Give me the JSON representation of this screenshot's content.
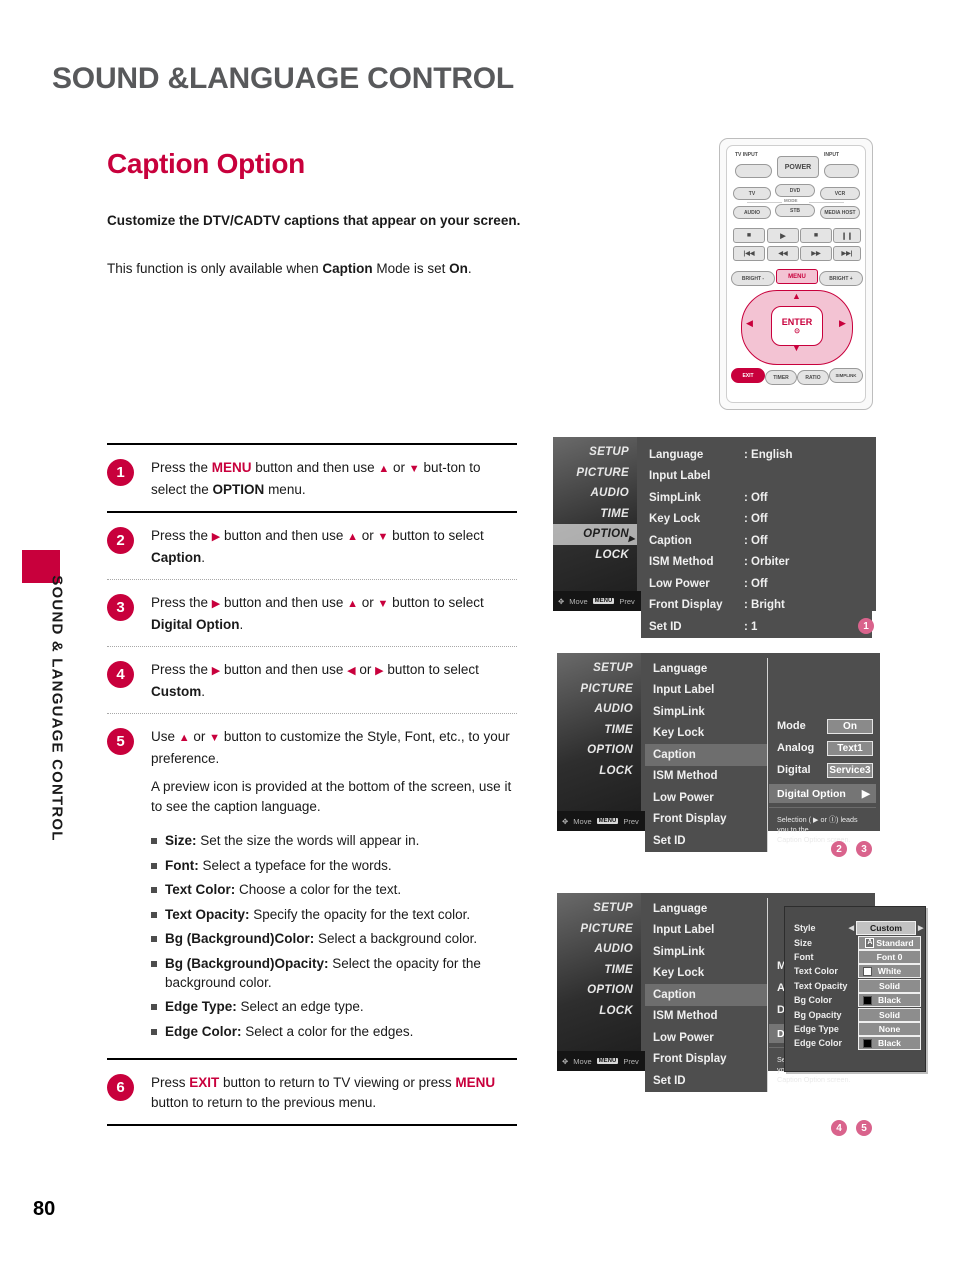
{
  "header": {
    "chapter": "SOUND &LANGUAGE CONTROL",
    "section": "Caption Option",
    "lead_bold": "Customize the DTV/CADTV captions that appear on your screen.",
    "lead_pre": "This function is only available when ",
    "lead_b1": "Caption",
    "lead_mid": " Mode is set ",
    "lead_b2": "On",
    "lead_end": "."
  },
  "sidebar": {
    "vertical_label": "SOUND & LANGUAGE CONTROL",
    "page_number": "80"
  },
  "steps": [
    {
      "num": "1",
      "pre": "Press the ",
      "k1": "MENU",
      "mid1": " button and then use ",
      "up": "▲",
      "or": " or ",
      "down": "▼",
      "mid2": " but-ton to select the ",
      "k2": "OPTION",
      "end": " menu."
    },
    {
      "num": "2",
      "pre": "Press the ",
      "k1": "▶",
      "mid1": " button and then use ",
      "up": "▲",
      "or": " or ",
      "down": "▼",
      "mid2": " button to select ",
      "k2": "Caption",
      "end": "."
    },
    {
      "num": "3",
      "pre": "Press the ",
      "k1": "▶",
      "mid1": " button and then use ",
      "up": "▲",
      "or": " or ",
      "down": "▼",
      "mid2": " button to select ",
      "k2": "Digital Option",
      "end": "."
    },
    {
      "num": "4",
      "pre": "Press the ",
      "k1": "▶",
      "mid1": " button and then use ",
      "up": "◀",
      "or": " or ",
      "down": "▶",
      "mid2": " button to select ",
      "k2": "Custom",
      "end": "."
    }
  ],
  "step5": {
    "num": "5",
    "pre": "Use ",
    "up": "▲",
    "or": " or ",
    "down": "▼",
    "post": " button to customize the Style, Font, etc., to your preference.",
    "para2": "A preview icon is provided at the bottom of the screen, use it to see the caption language.",
    "items": [
      {
        "term": "Size:",
        "desc": " Set the size the words will appear in."
      },
      {
        "term": "Font:",
        "desc": " Select a typeface for the words."
      },
      {
        "term": "Text Color:",
        "desc": " Choose a color for the text."
      },
      {
        "term": "Text Opacity:",
        "desc": " Specify the opacity for the text color."
      },
      {
        "term": "Bg (Background)Color:",
        "desc": " Select a background color."
      },
      {
        "term": "Bg (Background)Opacity:",
        "desc": " Select the opacity for the background color."
      },
      {
        "term": "Edge Type:",
        "desc": " Select an edge type."
      },
      {
        "term": "Edge Color:",
        "desc": " Select a color for the edges."
      }
    ]
  },
  "step6": {
    "num": "6",
    "pre": "Press ",
    "k1": "EXIT",
    "mid": " button to return to TV viewing or press ",
    "k2": "MENU",
    "end": " button to return to the previous menu."
  },
  "tv_menu": {
    "categories": [
      "SETUP",
      "PICTURE",
      "AUDIO",
      "TIME",
      "OPTION",
      "LOCK"
    ],
    "selected_category": "OPTION",
    "footer_move": "Move",
    "footer_menu_key": "MENU",
    "footer_prev": "Prev",
    "option_items": [
      {
        "label": "Language",
        "value": ": English"
      },
      {
        "label": "Input Label",
        "value": ""
      },
      {
        "label": "SimpLink",
        "value": ": Off"
      },
      {
        "label": "Key Lock",
        "value": ": Off"
      },
      {
        "label": "Caption",
        "value": ": Off"
      },
      {
        "label": "ISM Method",
        "value": ": Orbiter"
      },
      {
        "label": "Low Power",
        "value": ": Off"
      },
      {
        "label": "Front Display",
        "value": ": Bright"
      },
      {
        "label": "Set ID",
        "value": ": 1"
      }
    ],
    "option_items_plain": [
      "Language",
      "Input Label",
      "SimpLink",
      "Key Lock",
      "Caption",
      "ISM Method",
      "Low Power",
      "Front Display",
      "Set ID"
    ],
    "caption_panel": {
      "rows": [
        {
          "label": "Mode",
          "value": "On"
        },
        {
          "label": "Analog",
          "value": "Text1"
        },
        {
          "label": "Digital",
          "value": "Service3"
        }
      ],
      "digital_option_label": "Digital Option",
      "digital_option_arrow": "▶",
      "note_line1": "Selection ( ▶ or Ⓘ) leads you to the",
      "note_line2": "Caption Option screen."
    },
    "caption_option_panel": {
      "rows": [
        {
          "label": "Style",
          "value": "Custom",
          "swatch": "",
          "arrows": true,
          "highlight": true,
          "aicon": false
        },
        {
          "label": "Size",
          "value": "Standard",
          "swatch": "",
          "arrows": false,
          "highlight": false,
          "aicon": true
        },
        {
          "label": "Font",
          "value": "Font  0",
          "swatch": "",
          "arrows": false,
          "highlight": false,
          "aicon": false
        },
        {
          "label": "Text Color",
          "value": "White",
          "swatch": "#ffffff",
          "arrows": false,
          "highlight": false,
          "aicon": false
        },
        {
          "label": "Text Opacity",
          "value": "Solid",
          "swatch": "",
          "arrows": false,
          "highlight": false,
          "aicon": false
        },
        {
          "label": "Bg Color",
          "value": "Black",
          "swatch": "#000000",
          "arrows": false,
          "highlight": false,
          "aicon": false
        },
        {
          "label": "Bg Opacity",
          "value": "Solid",
          "swatch": "",
          "arrows": false,
          "highlight": false,
          "aicon": false
        },
        {
          "label": "Edge Type",
          "value": "None",
          "swatch": "",
          "arrows": false,
          "highlight": false,
          "aicon": false
        },
        {
          "label": "Edge Color",
          "value": "Black",
          "swatch": "#000000",
          "arrows": false,
          "highlight": false,
          "aicon": false
        }
      ],
      "arrow_left": "◀",
      "arrow_right": "▶"
    }
  },
  "markers": {
    "shot1": [
      "1"
    ],
    "shot2": [
      "2",
      "3"
    ],
    "shot3": [
      "4",
      "5"
    ]
  },
  "remote": {
    "tv_input": "TV INPUT",
    "power": "POWER",
    "input": "INPUT",
    "tv": "TV",
    "dvd": "DVD",
    "vcr": "VCR",
    "mode": "MODE",
    "audio": "AUDIO",
    "stb": "STB",
    "media_host": "MEDIA HOST",
    "bright_down": "BRIGHT -",
    "menu": "MENU",
    "bright_up": "BRIGHT +",
    "enter": "ENTER",
    "exit": "EXIT",
    "timer": "TIMER",
    "ratio": "RATIO",
    "simplink": "SIMPLINK"
  },
  "colors": {
    "accent": "#c8003c",
    "chapter_gray": "#58595b",
    "marker_pink": "#d9638c"
  }
}
